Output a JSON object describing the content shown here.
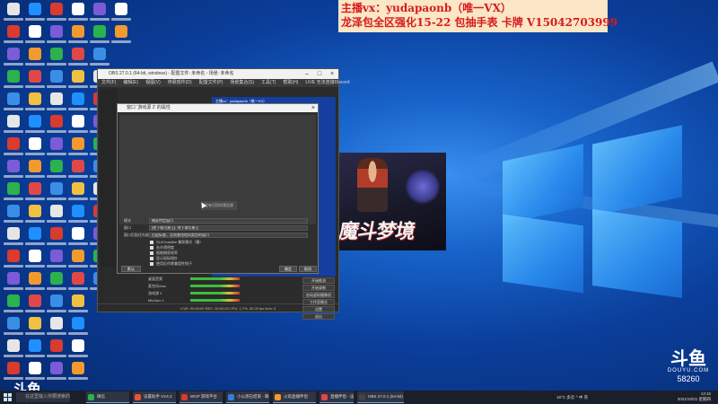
{
  "banner": {
    "line1": "主播vx：yudapaonb（唯一VX）",
    "line2": "龙泽包全区强化15-22 包抽手表 卡牌 V15042703999"
  },
  "obs": {
    "window_title": "OBS 27.0.1 (64-bit, windows) - 配置文件: 未命名 - 场景: 未命名",
    "menu": [
      "文件(F)",
      "编辑(E)",
      "视图(V)",
      "停靠部件(D)",
      "配置文件(P)",
      "场景集合(S)",
      "工具(T)",
      "帮助(H)",
      "LIVE 无法连接Discord"
    ],
    "preview_header": "主播vx：yudapaonb（唯一VX）",
    "status": "LIVE: 00:00:00   REC: 00:00:00   CPU: 1.7%, 30.00 fps   kb/s: 0"
  },
  "dialog": {
    "title": "窗口 '游戏源 2' 的属性",
    "preview_message": "没有可用的预览源",
    "rows": [
      {
        "key": "模式",
        "value": "捕获特定窗口"
      },
      {
        "key": "窗口",
        "value": "[地下城与勇士]: 地下城与勇士"
      },
      {
        "key": "窗口匹配优先级",
        "value": "匹配标题，否则查找相同类型的窗口"
      }
    ],
    "checks": [
      "SLI/Crossfire 捕获模式（慢）",
      "允许透明度",
      "限制捕获帧率",
      "显示鼠标指针",
      "使用反作弊兼容性钩子"
    ],
    "defaults_button": "默认",
    "ok_button": "确定",
    "cancel_button": "取消"
  },
  "mixer": {
    "rows": [
      "桌面音频",
      "麦克风/Aux",
      "游戏源 2",
      "Mic/Aux 2"
    ]
  },
  "controls": [
    "开始推流",
    "开始录制",
    "启动虚拟摄像机",
    "工作室模式",
    "设置",
    "退出"
  ],
  "game": {
    "title": "魔斗梦境"
  },
  "watermark": {
    "logo": "斗鱼",
    "subtitle": "DOUYU.COM",
    "room_number": "58260"
  },
  "taskbar": {
    "search_placeholder": "在这里输入你要搜索的内容",
    "apps": [
      {
        "label": "微信",
        "color": "#2bb24c"
      },
      {
        "label": "设置助手 VV4.2",
        "color": "#e7553a"
      },
      {
        "label": "WGP 游戏平台",
        "color": "#d93b2e"
      },
      {
        "label": "小公测已结束 - 聊天",
        "color": "#3a7ad9"
      },
      {
        "label": "火焰直播伴侣",
        "color": "#f29a2e"
      },
      {
        "label": "直播伴侣 - 设置",
        "color": "#e04848"
      },
      {
        "label": "OBS 27.0.1 (64-bit)",
        "color": "#444444"
      }
    ],
    "tray": "19°C  多云  ^  中  英",
    "time": "13:15",
    "date": "2021/10/21 星期四"
  },
  "colors": {
    "banner_text": "#d61b1b",
    "banner_bg": "#fbe6c6",
    "obs_bg": "#2b2b2b"
  }
}
